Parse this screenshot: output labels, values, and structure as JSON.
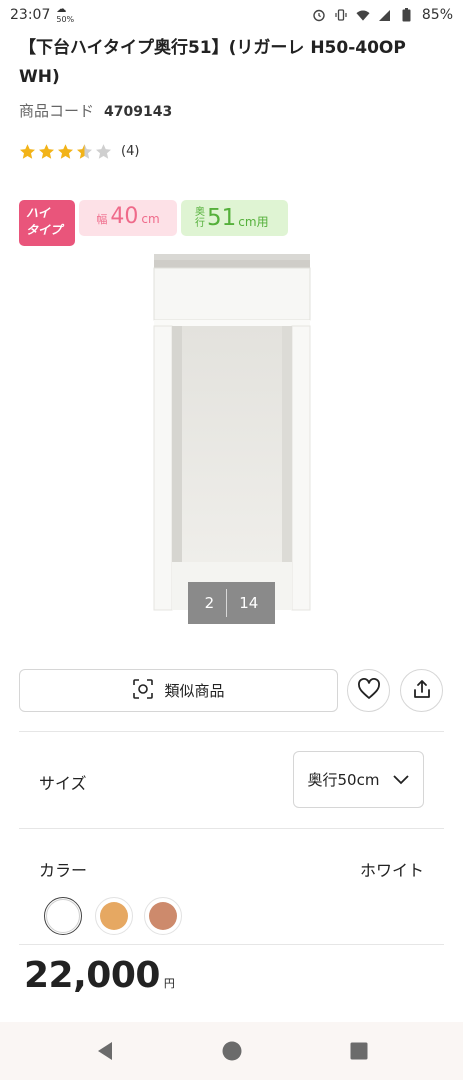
{
  "status_bar": {
    "time": "23:07",
    "notification_small": "50%",
    "battery": "85%",
    "icons": [
      "alarm-icon",
      "vibrate-icon",
      "wifi-icon",
      "signal-icon",
      "battery-icon"
    ]
  },
  "product": {
    "title": "【下台ハイタイプ奥行51】(リガーレ H50-40OP WH)",
    "code_label": "商品コード",
    "code_value": "4709143",
    "rating": {
      "stars": 3.5,
      "max": 5,
      "count_text": "(4)"
    },
    "badges": {
      "high_type": [
        "ハイ",
        "タイプ"
      ],
      "width_label": "幅",
      "width_value": "40",
      "width_unit": "cm",
      "depth_label": "奥行",
      "depth_value": "51",
      "depth_unit": "cm用"
    },
    "image_counter": {
      "current": "2",
      "total": "14"
    }
  },
  "actions": {
    "similar_button": "類似商品",
    "favorite_icon": "heart-icon",
    "share_icon": "share-icon"
  },
  "options": {
    "size_label": "サイズ",
    "size_selected": "奥行50cm",
    "color_label": "カラー",
    "color_selected": "ホワイト",
    "swatches": [
      {
        "name": "white",
        "color": "#ffffff",
        "selected": true
      },
      {
        "name": "light-wood",
        "color": "#e6a862"
      },
      {
        "name": "dark-wood",
        "color": "#cd8a6c"
      }
    ]
  },
  "price": {
    "amount": "22,000",
    "currency": "円"
  },
  "colors": {
    "accent_pink": "#e9557b",
    "badge_pink_bg": "#fde1e7",
    "badge_green_bg": "#dff4d3",
    "star_yellow": "#f2b318",
    "star_gray": "#cfcfcf"
  }
}
